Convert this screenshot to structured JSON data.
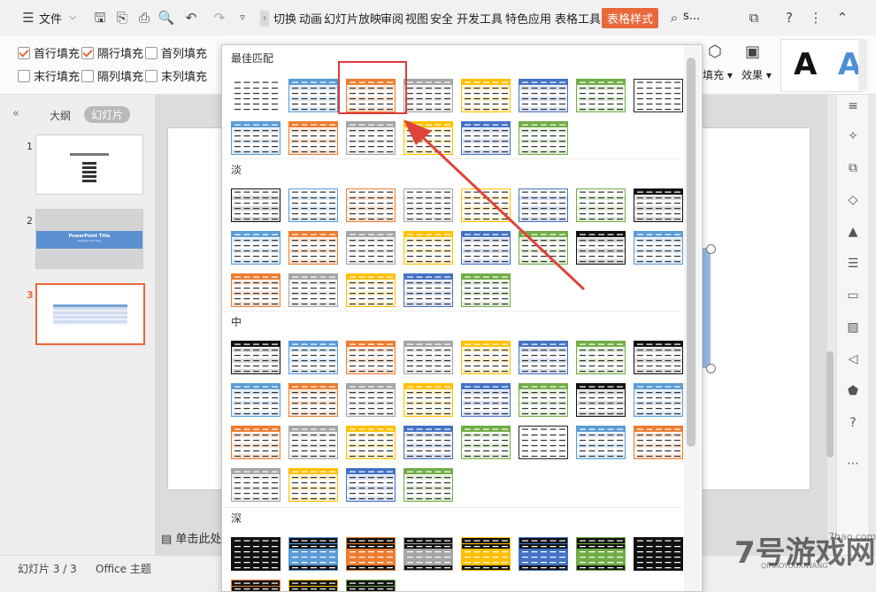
{
  "topbar": {
    "menu_label": "文件",
    "tabs": [
      "切换",
      "动画",
      "幻灯片放映",
      "审阅",
      "视图",
      "安全",
      "开发工具",
      "特色应用",
      "表格工具"
    ],
    "active_tab": "表格样式",
    "search_text": "s..."
  },
  "ribbon": {
    "options": [
      {
        "label": "首行填充",
        "checked": true
      },
      {
        "label": "隔行填充",
        "checked": true
      },
      {
        "label": "首列填充",
        "checked": false
      },
      {
        "label": "末行填充",
        "checked": false
      },
      {
        "label": "隔列填充",
        "checked": false
      },
      {
        "label": "末列填充",
        "checked": false
      }
    ],
    "fill_label": "填充",
    "effect_label": "效果",
    "text_style_label": "A"
  },
  "leftpanel": {
    "tab_outline": "大纲",
    "tab_slides": "幻灯片",
    "slide_numbers": [
      "1",
      "2",
      "3"
    ],
    "slide2_title": "PowerPoint Title",
    "slide2_subtitle": "Subtitle Text Here"
  },
  "dropdown": {
    "sections": [
      {
        "title": "最佳匹配"
      },
      {
        "title": "淡"
      },
      {
        "title": "中"
      },
      {
        "title": "深"
      }
    ]
  },
  "status": {
    "slide_count": "幻灯片 3 / 3",
    "theme": "Office 主题",
    "notes_placeholder": "单击此处"
  },
  "watermark": {
    "brand": "7号游戏网",
    "site": "7hao.com",
    "pinyin": "QIHAOYOUXIWANG"
  },
  "colors": {
    "accent": "#e8683a",
    "highlight_box": "#e03a3a",
    "arrow": "#e0433a"
  }
}
